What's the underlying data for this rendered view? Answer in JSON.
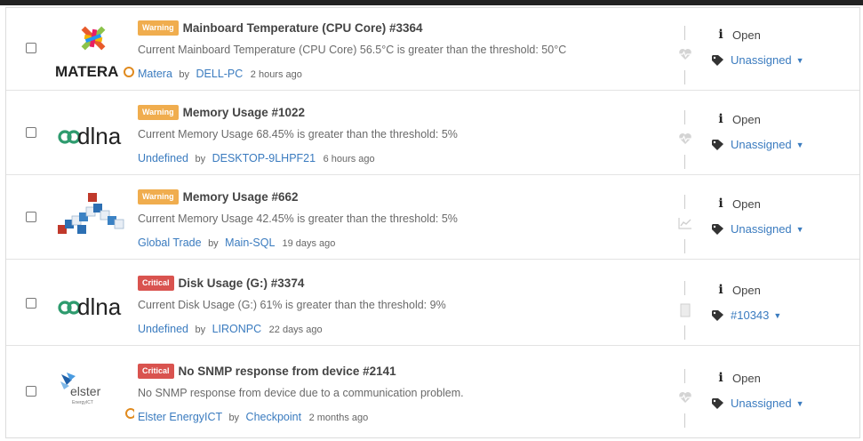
{
  "alerts": [
    {
      "severity": "Warning",
      "title": "Mainboard Temperature (CPU Core) #3364",
      "description": "Current Mainboard Temperature (CPU Core) 56.5°C is greater than the threshold: 50°C",
      "customer": "Matera",
      "by": "by",
      "device": "DELL-PC",
      "time": "2 hours ago",
      "status": "Open",
      "assignee": "Unassigned",
      "logo": "MATERA",
      "mid_icon": "heartbeat-icon"
    },
    {
      "severity": "Warning",
      "title": "Memory Usage #1022",
      "description": "Current Memory Usage 68.45% is greater than the threshold: 5%",
      "customer": "Undefined",
      "by": "by",
      "device": "DESKTOP-9LHPF21",
      "time": "6 hours ago",
      "status": "Open",
      "assignee": "Unassigned",
      "logo": "dlna",
      "mid_icon": "heartbeat-icon"
    },
    {
      "severity": "Warning",
      "title": "Memory Usage #662",
      "description": "Current Memory Usage 42.45% is greater than the threshold: 5%",
      "customer": "Global Trade",
      "by": "by",
      "device": "Main-SQL",
      "time": "19 days ago",
      "status": "Open",
      "assignee": "Unassigned",
      "logo": "cubes",
      "mid_icon": "chart-icon"
    },
    {
      "severity": "Critical",
      "title": "Disk Usage (G:) #3374",
      "description": "Current Disk Usage (G:) 61% is greater than the threshold: 9%",
      "customer": "Undefined",
      "by": "by",
      "device": "LIRONPC",
      "time": "22 days ago",
      "status": "Open",
      "assignee": "#10343",
      "logo": "dlna",
      "mid_icon": "document-icon"
    },
    {
      "severity": "Critical",
      "title": "No SNMP response from device #2141",
      "description": "No SNMP response from device due to a communication problem.",
      "customer": "Elster EnergyICT",
      "by": "by",
      "device": "Checkpoint",
      "time": "2 months ago",
      "status": "Open",
      "assignee": "Unassigned",
      "logo": "elster",
      "logo_sub": "EnergyICT",
      "mid_icon": "heartbeat-icon"
    }
  ],
  "colors": {
    "warning": "#f0ad4e",
    "critical": "#d9534f",
    "link": "#3a7bbf"
  }
}
